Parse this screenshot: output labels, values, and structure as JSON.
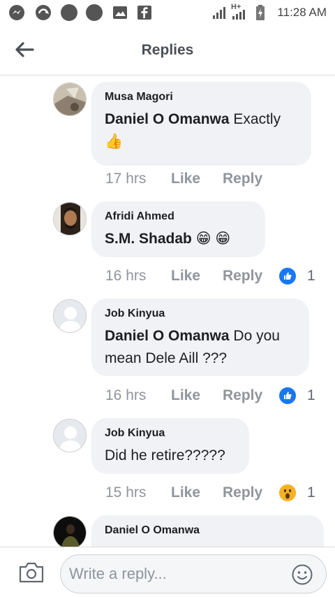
{
  "status_bar": {
    "time": "11:28 AM",
    "network": "H+"
  },
  "header": {
    "title": "Replies"
  },
  "comments": [
    {
      "author": "Musa Magori",
      "mention": "Daniel O Omanwa",
      "text": "Exactly",
      "emoji": "👍",
      "time": "17 hrs",
      "like": "Like",
      "reply": "Reply",
      "reaction": "",
      "reaction_count": ""
    },
    {
      "author": "Afridi Ahmed",
      "mention": "S.M. Shadab",
      "text": "😁 😁",
      "time": "16 hrs",
      "like": "Like",
      "reply": "Reply",
      "reaction": "like",
      "reaction_count": "1"
    },
    {
      "author": "Job Kinyua",
      "mention": "Daniel O Omanwa",
      "text": "Do you mean Dele  Aill ???",
      "time": "16 hrs",
      "like": "Like",
      "reply": "Reply",
      "reaction": "like",
      "reaction_count": "1"
    },
    {
      "author": "Job Kinyua",
      "mention": "",
      "text": "Did he retire?????",
      "time": "15 hrs",
      "like": "Like",
      "reply": "Reply",
      "reaction": "wow",
      "reaction_count": "1"
    },
    {
      "author": "Daniel O Omanwa"
    }
  ],
  "composer": {
    "placeholder": "Write a reply..."
  },
  "colors": {
    "like_blue": "#1877f2",
    "bubble_bg": "#f0f2f5",
    "meta_gray": "#90949c",
    "wow_yellow": "#f7b125"
  },
  "icons": {
    "back": "arrow-left-icon",
    "camera": "camera-icon",
    "emoji": "smiley-icon",
    "like_reaction": "thumbs-up-reaction-icon",
    "wow_reaction": "wow-reaction-icon"
  }
}
